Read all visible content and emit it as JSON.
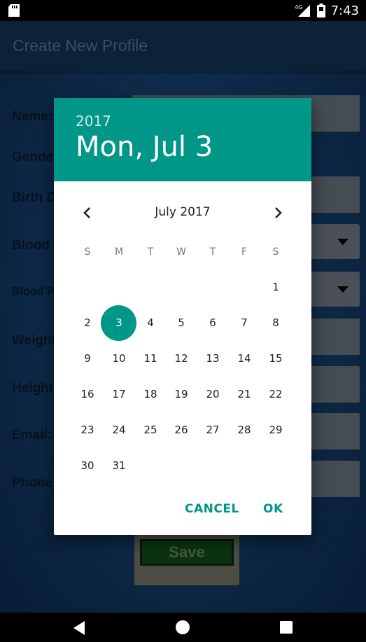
{
  "status_bar": {
    "time": "7:43",
    "network": "4G",
    "icons": [
      "sd-card-icon",
      "signal-icon",
      "battery-icon"
    ]
  },
  "app": {
    "title": "Create New Profile",
    "form_labels": {
      "name": "Name:",
      "gender": "Gender",
      "birth_date": "Birth D",
      "blood_group": "Blood G",
      "blood_pressure": "Blood P",
      "weight": "Weight",
      "height": "Height",
      "email": "Email:",
      "phone": "Phone"
    },
    "save_label": "Save"
  },
  "date_picker": {
    "year": "2017",
    "selected_date": "Mon, Jul 3",
    "month_label": "July 2017",
    "weekdays": [
      "S",
      "M",
      "T",
      "W",
      "T",
      "F",
      "S"
    ],
    "days": [
      "1",
      "2",
      "3",
      "4",
      "5",
      "6",
      "7",
      "8",
      "9",
      "10",
      "11",
      "12",
      "13",
      "14",
      "15",
      "16",
      "17",
      "18",
      "19",
      "20",
      "21",
      "22",
      "23",
      "24",
      "25",
      "26",
      "27",
      "28",
      "29",
      "30",
      "31"
    ],
    "selected_day": "3",
    "cancel_label": "CANCEL",
    "ok_label": "OK",
    "accent_color": "#009688"
  }
}
